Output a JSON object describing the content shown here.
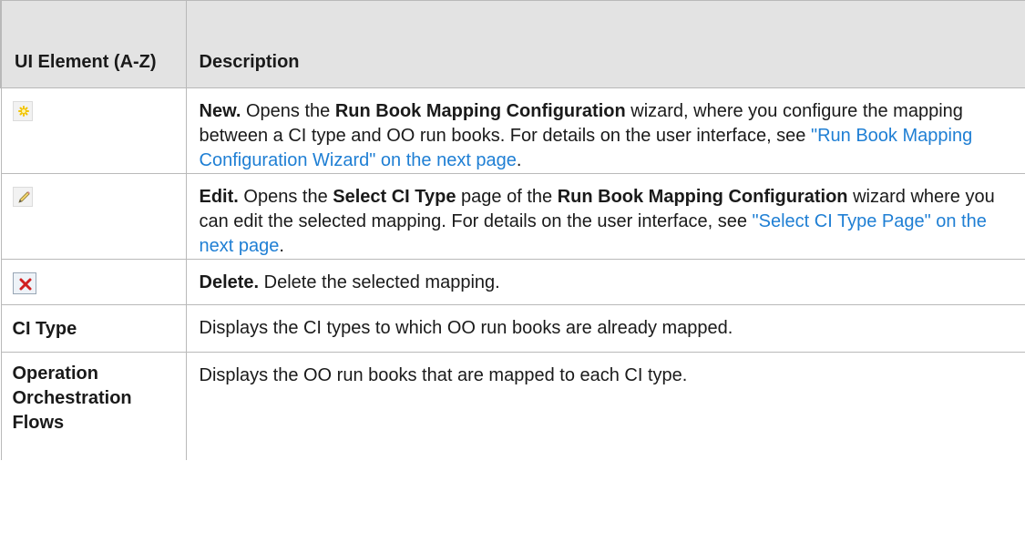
{
  "table": {
    "headers": [
      "UI Element (A-Z)",
      "Description"
    ],
    "rows": [
      {
        "element_icon": "new-icon",
        "desc": {
          "b1": "New.",
          "t1": " Opens the ",
          "b2": "Run Book Mapping Configuration",
          "t2": " wizard, where you configure the mapping between a CI type and OO run books. For details on the user interface, see ",
          "link": "\"Run Book Mapping Configuration Wizard\" on the next page",
          "t3": "."
        }
      },
      {
        "element_icon": "edit-icon",
        "desc": {
          "b1": "Edit.",
          "t1": " Opens the ",
          "b2": "Select CI Type",
          "t2": " page of the ",
          "b3": "Run Book Mapping Configuration",
          "t3": " wizard where you can edit the selected mapping. For details on the user interface, see ",
          "link": "\"Select CI Type Page\" on the next page",
          "t4": "."
        }
      },
      {
        "element_icon": "delete-icon",
        "desc": {
          "b1": "Delete.",
          "t1": " Delete the selected mapping."
        }
      },
      {
        "element": "CI Type",
        "desc": {
          "t1": "Displays the CI types to which OO run books are already mapped."
        }
      },
      {
        "element": "Operation Orchestration Flows",
        "desc": {
          "t1": "Displays the OO run books that are mapped to each CI type."
        }
      }
    ]
  },
  "colors": {
    "header_bg": "#e3e3e3",
    "border": "#b9b9b9",
    "link": "#1f7fd4"
  }
}
